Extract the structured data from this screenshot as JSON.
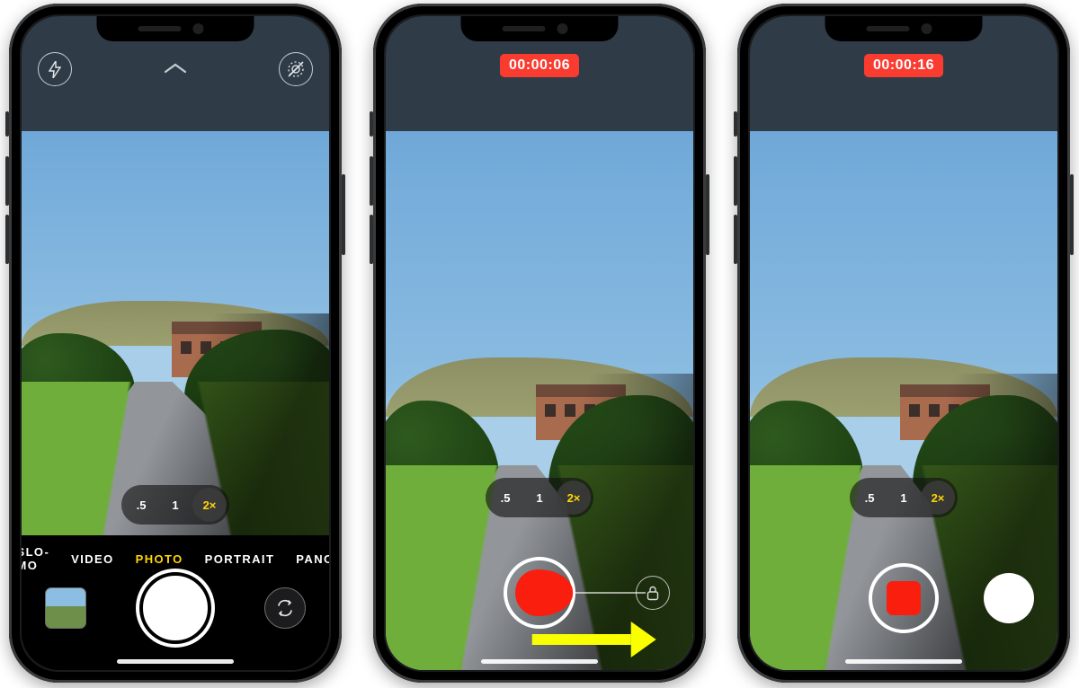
{
  "zoom": {
    "options": [
      ".5",
      "1",
      "2×"
    ],
    "active_index": 2
  },
  "screen1": {
    "modes": [
      "SLO-MO",
      "VIDEO",
      "PHOTO",
      "PORTRAIT",
      "PANO"
    ],
    "active_mode_index": 2
  },
  "screen2": {
    "timer": "00:00:06",
    "gesture_hint": "slide-right-to-lock"
  },
  "screen3": {
    "timer": "00:00:16"
  }
}
